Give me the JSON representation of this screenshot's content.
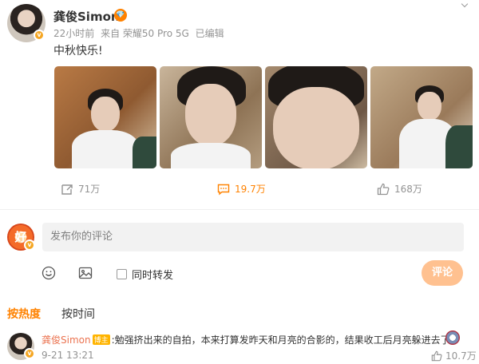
{
  "post": {
    "username": "龚俊Simon",
    "member_badge": "💎",
    "verified_mark": "v",
    "meta": {
      "time": "22小时前",
      "source": "来自 荣耀50 Pro 5G",
      "edited": "已编辑"
    },
    "text": "中秋快乐!",
    "photos": [
      {
        "alt": "photo-1"
      },
      {
        "alt": "photo-2"
      },
      {
        "alt": "photo-3"
      },
      {
        "alt": "photo-4"
      }
    ]
  },
  "actions": {
    "repost_count": "71万",
    "comment_count": "19.7万",
    "like_count": "168万"
  },
  "composer": {
    "avatar_text": "好",
    "placeholder": "发布你的评论",
    "repost_label": "同时转发",
    "submit_label": "评论"
  },
  "sort": {
    "hot_label": "按热度",
    "time_label": "按时间"
  },
  "top_comment": {
    "user": "龚俊Simon",
    "tag": "博主",
    "text": ":勉强挤出来的自拍，本来打算发昨天和月亮的合影的，结果收工后月亮躲进去了。",
    "time": "9-21 13:21",
    "likes": "10.7万"
  },
  "colors": {
    "accent": "#ff8200",
    "submit_disabled": "#ffc190",
    "comment_user": "#eb7350",
    "meta_gray": "#939393"
  }
}
